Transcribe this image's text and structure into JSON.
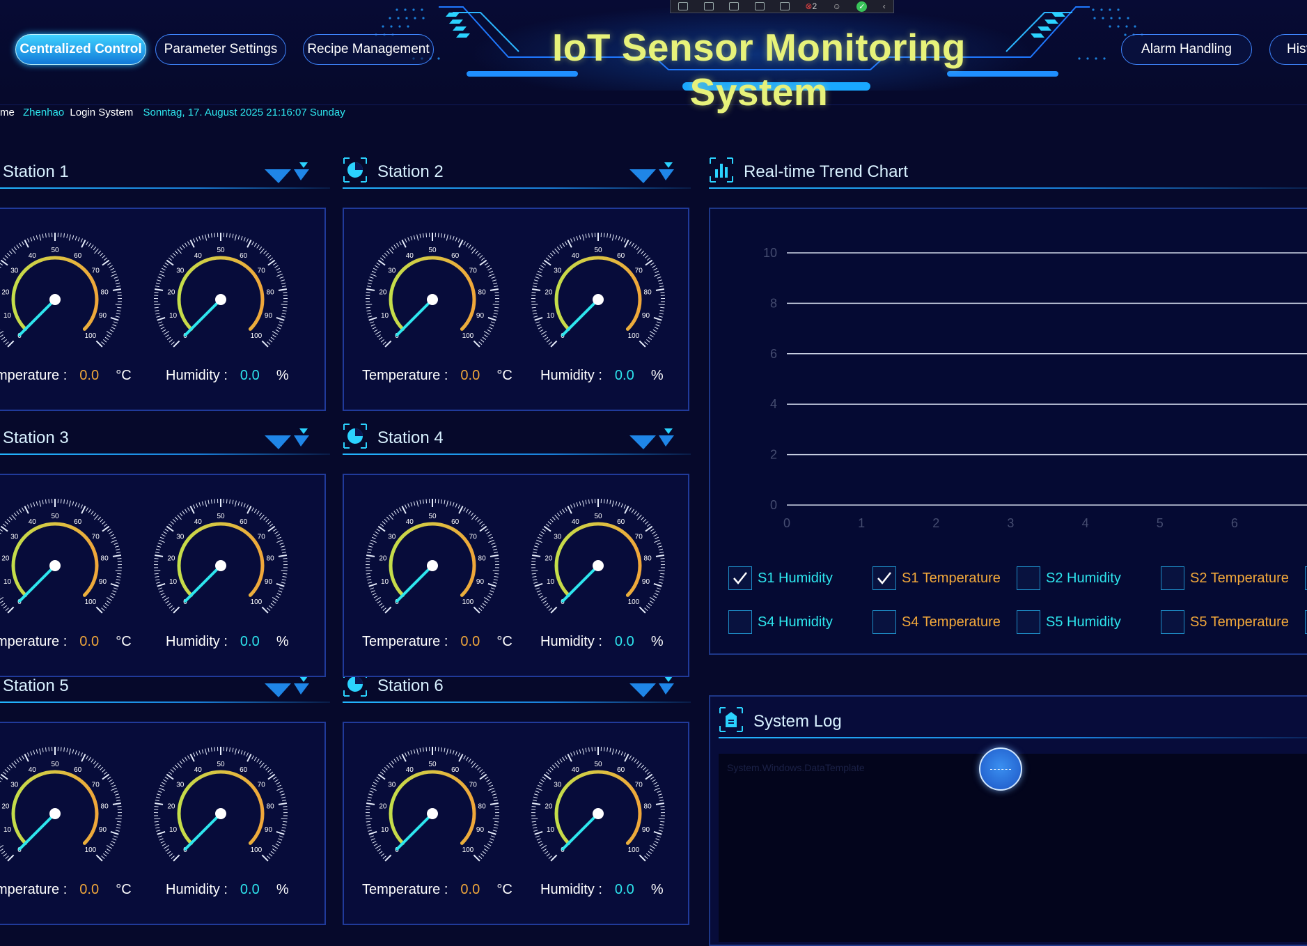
{
  "header": {
    "title": "IoT Sensor Monitoring System",
    "nav": [
      {
        "label": "Centralized Control",
        "active": true
      },
      {
        "label": "Parameter Settings",
        "active": false
      },
      {
        "label": "Recipe Management",
        "active": false
      },
      {
        "label": "Alarm Handling",
        "active": false
      },
      {
        "label": "Hist",
        "active": false
      }
    ],
    "toolbar_count": "2"
  },
  "status": {
    "prefix": "me",
    "user": "Zhenhao",
    "system": "Login System",
    "datetime": "Sonntag, 17. August 2025 21:16:07 Sunday"
  },
  "reading_labels": {
    "temperature": "Temperature :",
    "temperature_cut": "mperature :",
    "humidity": "Humidity :",
    "temp_unit": "°C",
    "hum_unit": "%"
  },
  "stations": [
    {
      "name": "Station 1",
      "temperature": "0.0",
      "humidity": "0.0"
    },
    {
      "name": "Station 2",
      "temperature": "0.0",
      "humidity": "0.0"
    },
    {
      "name": "Station 3",
      "temperature": "0.0",
      "humidity": "0.0"
    },
    {
      "name": "Station 4",
      "temperature": "0.0",
      "humidity": "0.0"
    },
    {
      "name": "Station 5",
      "temperature": "0.0",
      "humidity": "0.0"
    },
    {
      "name": "Station 6",
      "temperature": "0.0",
      "humidity": "0.0"
    }
  ],
  "gauge": {
    "min": 0,
    "max": 100,
    "tick_labels": [
      "0",
      "10",
      "20",
      "30",
      "40",
      "50",
      "60",
      "70",
      "80",
      "90",
      "100"
    ],
    "colors": {
      "start": "#c4de4a",
      "end": "#f0a73a",
      "needle": "#2ee6ee"
    }
  },
  "trend": {
    "title": "Real-time Trend Chart",
    "checkboxes": [
      {
        "label": "S1 Humidity",
        "checked": true,
        "color": "#2ee6ee"
      },
      {
        "label": "S1 Temperature",
        "checked": true,
        "color": "#f2a83b"
      },
      {
        "label": "S2 Humidity",
        "checked": false,
        "color": "#2ee6ee"
      },
      {
        "label": "S2 Temperature",
        "checked": false,
        "color": "#f2a83b"
      },
      {
        "label": "S4 Humidity",
        "checked": false,
        "color": "#2ee6ee"
      },
      {
        "label": "S4 Temperature",
        "checked": false,
        "color": "#f2a83b"
      },
      {
        "label": "S5 Humidity",
        "checked": false,
        "color": "#2ee6ee"
      },
      {
        "label": "S5 Temperature",
        "checked": false,
        "color": "#f2a83b"
      }
    ]
  },
  "chart_data": {
    "type": "line",
    "title": "",
    "xlabel": "",
    "ylabel": "",
    "x_ticks": [
      "0",
      "1",
      "2",
      "3",
      "4",
      "5",
      "6"
    ],
    "y_ticks": [
      "0",
      "2",
      "4",
      "6",
      "8",
      "10"
    ],
    "xlim": [
      0,
      7
    ],
    "ylim": [
      0,
      10
    ],
    "grid": true,
    "series": []
  },
  "log": {
    "title": "System Log",
    "text": "System.Windows.DataTemplate"
  },
  "colors": {
    "accent": "#2ee6ee",
    "temperature": "#f2a83b",
    "title": "#e7f27a",
    "background": "#06092b"
  }
}
